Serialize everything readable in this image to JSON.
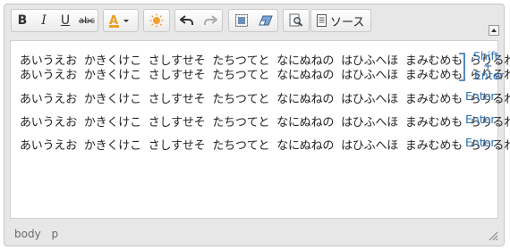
{
  "toolbar": {
    "source_label": "ソース",
    "strike_label": "abc",
    "buttons": [
      "bold",
      "italic",
      "underline",
      "strikethrough",
      "text-color",
      "special",
      "undo",
      "redo",
      "select-all",
      "remove-format",
      "find",
      "source"
    ]
  },
  "content": {
    "lines": [
      "あいうえお  かきくけこ  さしすせそ  たちつてと  なにぬねの  はひふへほ  まみむめも  らりるれろ",
      "あいうえお  かきくけこ  さしすせそ  たちつてと  なにぬねの  はひふへほ  まみむめも  らりるれろ",
      "あいうえお  かきくけこ  さしすせそ  たちつてと  なにぬねの  はひふへほ  まみむめも  らりるれろ",
      "あいうえお  かきくけこ  さしすせそ  たちつてと  なにぬねの  はひふへほ  まみむめも  らりるれろ",
      "あいうえお  かきくけこ  さしすせそ  たちつてと  なにぬねの  はひふへほ  まみむめも  らりるれろ"
    ],
    "annotations": {
      "shift": "Shift",
      "plus": "+",
      "enter_first": "Enter",
      "enter_1": "Enter",
      "enter_2": "Enter",
      "enter_3": "Enter"
    }
  },
  "statusbar": {
    "path": [
      "body",
      "p"
    ]
  },
  "colors": {
    "accent_blue": "#2a6fb3",
    "toolbar_bg": "#e7e7e7",
    "text_color_icon": "#e8a020"
  }
}
